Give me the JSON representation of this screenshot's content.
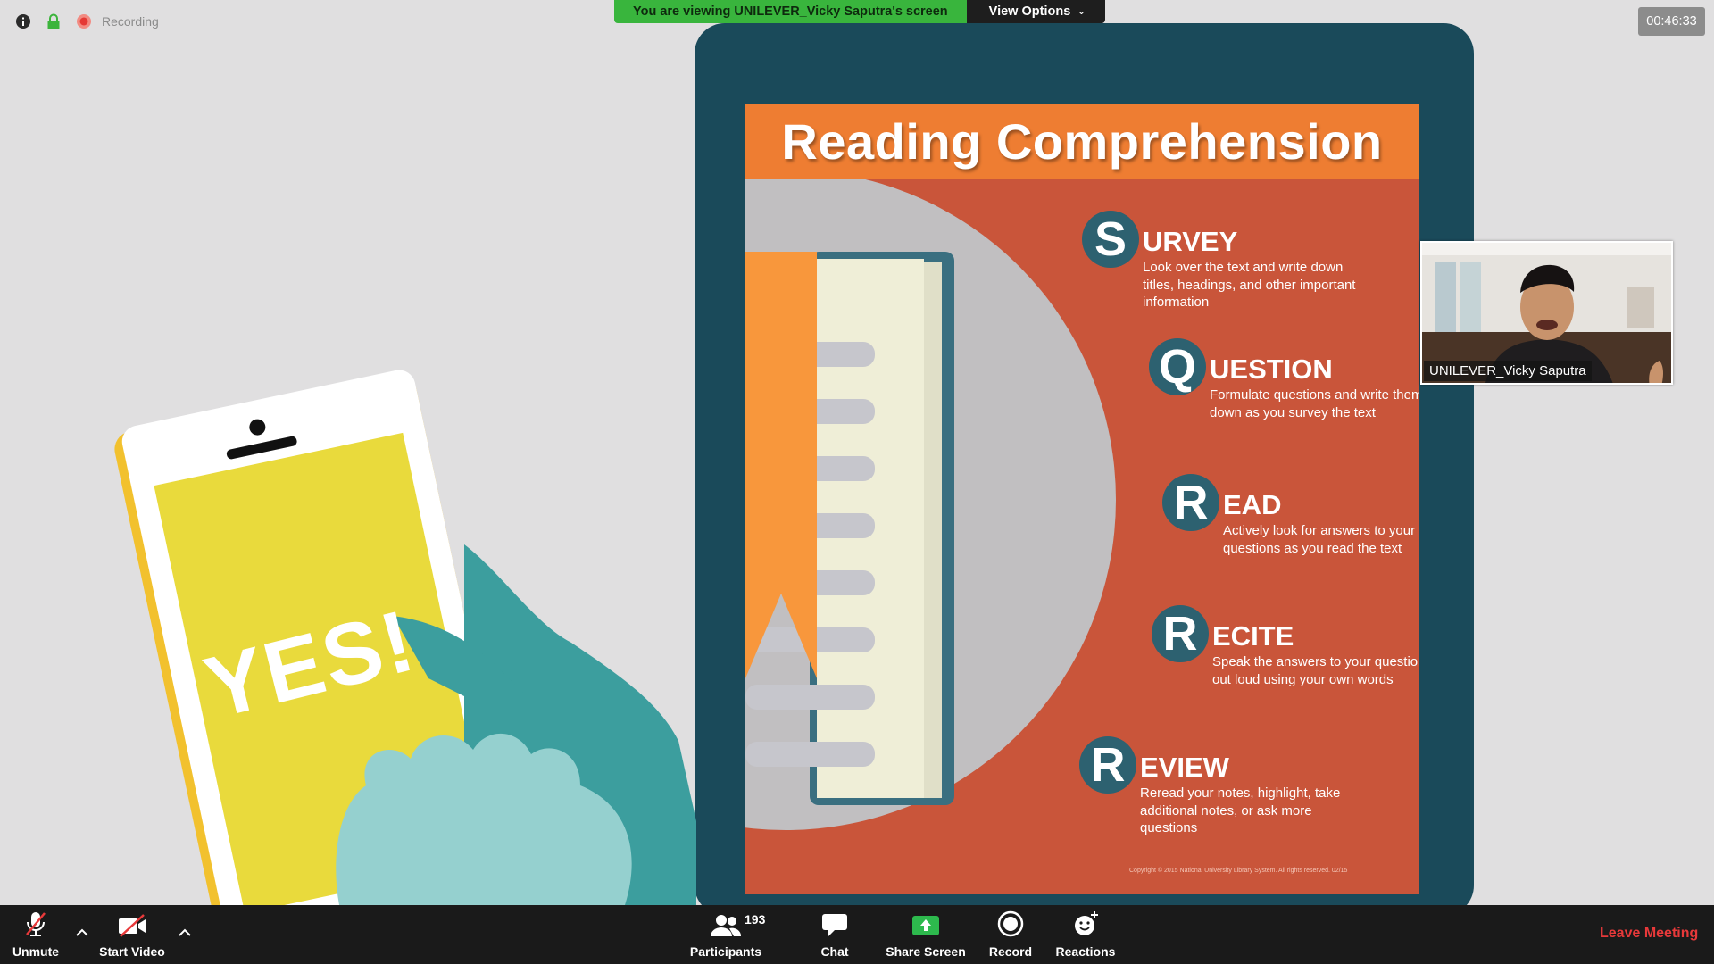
{
  "meeting": {
    "status_icons": [
      "info-icon",
      "lock-icon",
      "recording-icon"
    ],
    "recording_label": "Recording",
    "viewing_banner": "You are viewing UNILEVER_Vicky Saputra's screen",
    "view_options_label": "View Options",
    "timer": "00:46:33"
  },
  "shared_screen": {
    "phone_text": "YES!",
    "poster": {
      "title": "Reading Comprehension",
      "steps": [
        {
          "letter": "S",
          "word": "URVEY",
          "description": "Look over the text and write down titles, headings, and other important information"
        },
        {
          "letter": "Q",
          "word": "UESTION",
          "description": "Formulate questions and write them down as you survey the text"
        },
        {
          "letter": "R",
          "word": "EAD",
          "description": "Actively look for answers to your questions as you read the text"
        },
        {
          "letter": "R",
          "word": "ECITE",
          "description": "Speak the answers to your questions out loud using your own words"
        },
        {
          "letter": "R",
          "word": "EVIEW",
          "description": "Reread your notes, highlight, take additional notes, or ask more questions"
        }
      ],
      "copyright": "Copyright © 2015 National University Library System. All rights reserved. 02/15"
    }
  },
  "participant_video": {
    "name": "UNILEVER_Vicky Saputra"
  },
  "toolbar": {
    "unmute_label": "Unmute",
    "start_video_label": "Start Video",
    "participants_label": "Participants",
    "participants_count": "193",
    "chat_label": "Chat",
    "share_screen_label": "Share Screen",
    "record_label": "Record",
    "reactions_label": "Reactions",
    "leave_label": "Leave Meeting",
    "accent_share": "#2db94d",
    "accent_leave": "#e8393a"
  }
}
